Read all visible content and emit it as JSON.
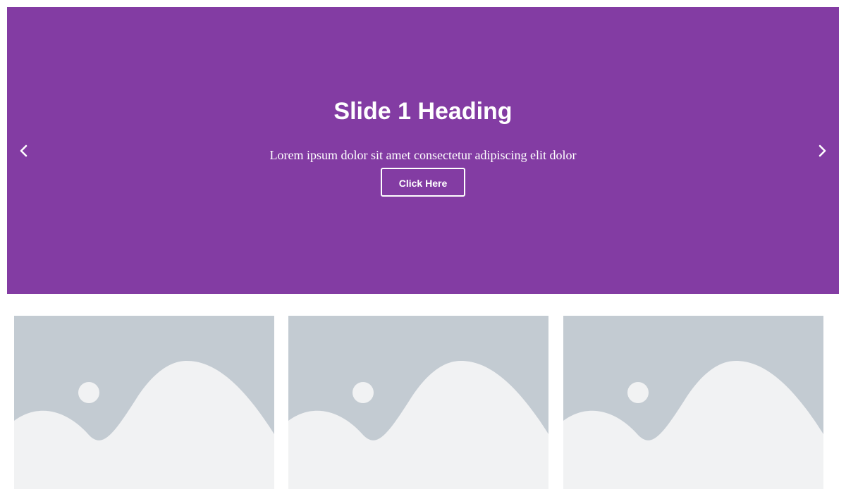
{
  "slider": {
    "background_color": "#833ca3",
    "prev_icon": "chevron-left-icon",
    "next_icon": "chevron-right-icon",
    "slide": {
      "heading": "Slide 1 Heading",
      "description": "Lorem ipsum dolor sit amet consectetur adipiscing elit dolor",
      "button_label": "Click Here"
    }
  },
  "gallery": {
    "items": [
      {
        "icon": "placeholder-image-icon"
      },
      {
        "icon": "placeholder-image-icon"
      },
      {
        "icon": "placeholder-image-icon"
      }
    ],
    "placeholder_bg": "#c3cbd2",
    "placeholder_fg": "#f1f2f3"
  }
}
